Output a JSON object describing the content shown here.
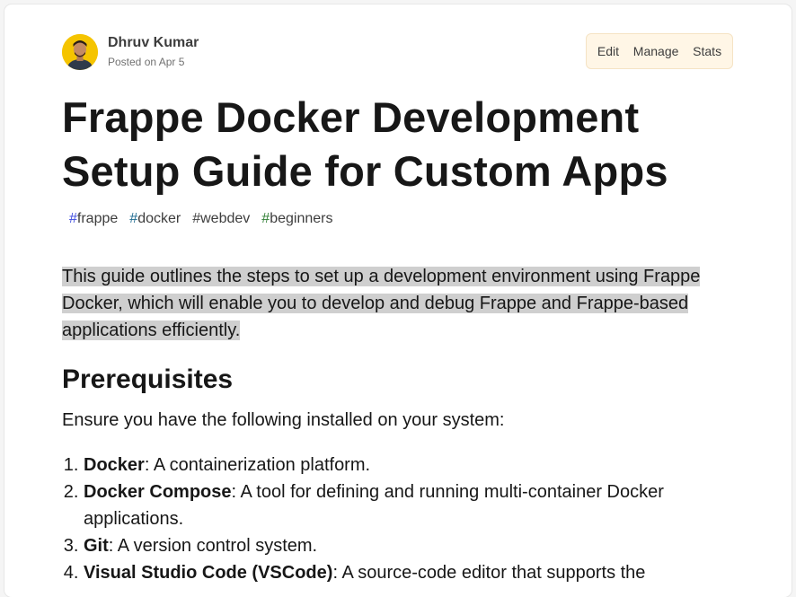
{
  "author": {
    "name": "Dhruv Kumar",
    "posted": "Posted on Apr 5"
  },
  "actions": {
    "edit": "Edit",
    "manage": "Manage",
    "stats": "Stats"
  },
  "article": {
    "title": "Frappe Docker Development Setup Guide for Custom Apps",
    "tags": [
      {
        "hash": "#",
        "name": "frappe",
        "color": "#3b49df"
      },
      {
        "hash": "#",
        "name": "docker",
        "color": "#1d6a8f"
      },
      {
        "hash": "#",
        "name": "webdev",
        "color": "#3d3d3d"
      },
      {
        "hash": "#",
        "name": "beginners",
        "color": "#2e7d32"
      }
    ],
    "intro": "This guide outlines the steps to set up a development environment using Frappe Docker, which will enable you to develop and debug Frappe and Frappe-based applications efficiently.",
    "prereq_heading": "Prerequisites",
    "prereq_lead": "Ensure you have the following installed on your system:",
    "prereq_items": [
      {
        "term": "Docker",
        "desc": ": A containerization platform."
      },
      {
        "term": "Docker Compose",
        "desc": ": A tool for defining and running multi-container Docker applications."
      },
      {
        "term": "Git",
        "desc": ": A version control system."
      },
      {
        "term": "Visual Studio Code (VSCode)",
        "desc": ": A source-code editor that supports the"
      }
    ]
  }
}
